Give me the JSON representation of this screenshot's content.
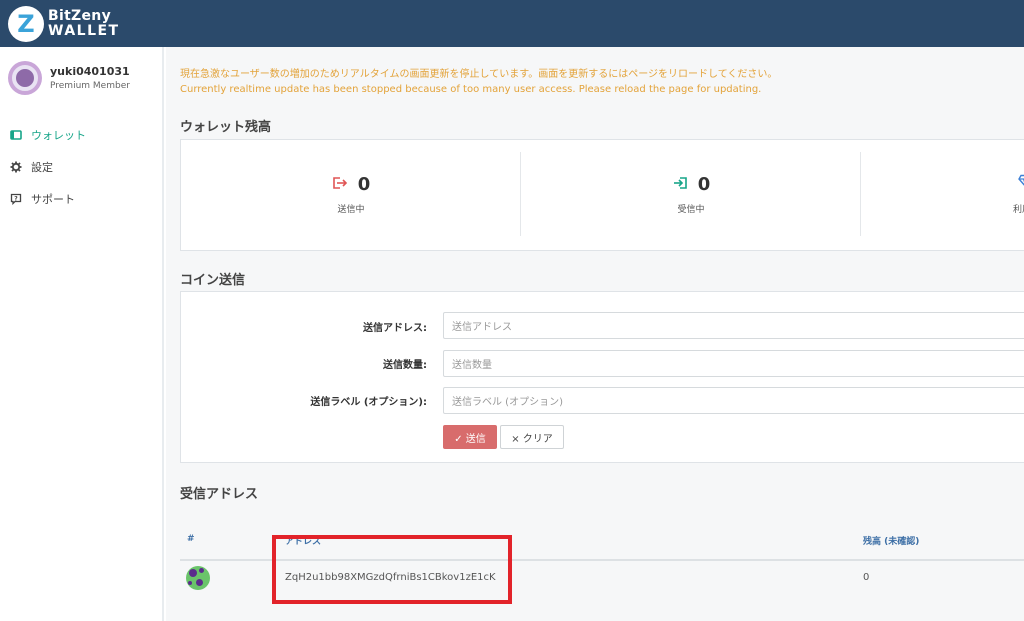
{
  "header": {
    "logo_line1": "BitZeny",
    "logo_line2": "WALLET",
    "logo_mark": "Z",
    "brand_color": "#2b4a6b"
  },
  "sidebar": {
    "user": {
      "name": "yuki0401031",
      "role": "Premium Member"
    },
    "items": [
      {
        "label": "ウォレット",
        "icon": "wallet-icon",
        "active": true
      },
      {
        "label": "設定",
        "icon": "gear-icon",
        "active": false
      },
      {
        "label": "サポート",
        "icon": "support-icon",
        "active": false
      }
    ]
  },
  "main": {
    "notice_ja": "現在急激なユーザー数の増加のためリアルタイムの画面更新を停止しています。画面を更新するにはページをリロードしてください。",
    "notice_en": "Currently realtime update has been stopped because of too many user access. Please reload the page for updating.",
    "wallet_title": "ウォレット残高",
    "balances": [
      {
        "value": "0",
        "label": "送信中",
        "icon": "send-out-icon",
        "color": "#e05555"
      },
      {
        "value": "0",
        "label": "受信中",
        "icon": "receive-in-icon",
        "color": "#17a589"
      },
      {
        "value": "",
        "label": "利用可能",
        "icon": "diamond-icon",
        "color": "#3d7fd6"
      }
    ],
    "send_title": "コイン送信",
    "send_form": {
      "address_label": "送信アドレス:",
      "address_placeholder": "送信アドレス",
      "amount_label": "送信数量:",
      "amount_placeholder": "送信数量",
      "memo_label": "送信ラベル (オプション):",
      "memo_placeholder": "送信ラベル (オプション)",
      "send_button": "✓ 送信",
      "clear_button": "× クリア"
    },
    "receive_title": "受信アドレス",
    "receive_table": {
      "columns": [
        "#",
        "アドレス",
        "残高 (未確認)"
      ],
      "rows": [
        {
          "address": "ZqH2u1bb98XMGzdQfrniBs1CBkov1zE1cK",
          "balance": "0"
        }
      ]
    }
  }
}
